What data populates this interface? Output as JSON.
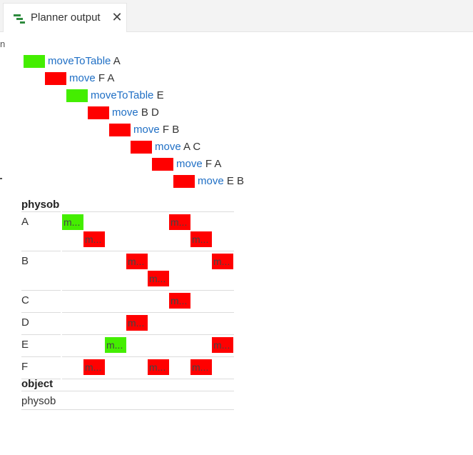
{
  "colors": {
    "green": "#44ee00",
    "red": "#ff0000",
    "action_link": "#1f6fc5"
  },
  "tab": {
    "title": "Planner output",
    "icon": "planner-tree-icon",
    "close_glyph": "✕"
  },
  "plan": [
    {
      "action": "moveToTable",
      "args": "A",
      "color": "green"
    },
    {
      "action": "move",
      "args": "F A",
      "color": "red"
    },
    {
      "action": "moveToTable",
      "args": "E",
      "color": "green"
    },
    {
      "action": "move",
      "args": "B D",
      "color": "red"
    },
    {
      "action": "move",
      "args": "F B",
      "color": "red"
    },
    {
      "action": "move",
      "args": "A C",
      "color": "red"
    },
    {
      "action": "move",
      "args": "F A",
      "color": "red"
    },
    {
      "action": "move",
      "args": "E B",
      "color": "red"
    }
  ],
  "timeline": {
    "section_title": "physob",
    "chip_label": "m...",
    "rows": [
      {
        "label": "A",
        "chips": [
          {
            "step": 0,
            "lane": 0
          },
          {
            "step": 5,
            "lane": 0
          },
          {
            "step": 1,
            "lane": 1
          },
          {
            "step": 6,
            "lane": 1
          }
        ]
      },
      {
        "label": "B",
        "chips": [
          {
            "step": 3,
            "lane": 0
          },
          {
            "step": 7,
            "lane": 0
          },
          {
            "step": 4,
            "lane": 1
          }
        ]
      },
      {
        "label": "C",
        "chips": [
          {
            "step": 5,
            "lane": 0
          }
        ]
      },
      {
        "label": "D",
        "chips": [
          {
            "step": 3,
            "lane": 0
          }
        ]
      },
      {
        "label": "E",
        "chips": [
          {
            "step": 2,
            "lane": 0
          },
          {
            "step": 7,
            "lane": 0
          }
        ]
      },
      {
        "label": "F",
        "chips": [
          {
            "step": 1,
            "lane": 0
          },
          {
            "step": 4,
            "lane": 0
          },
          {
            "step": 6,
            "lane": 0
          }
        ]
      }
    ]
  },
  "objects": {
    "section_title": "object",
    "items": [
      "physob"
    ]
  }
}
